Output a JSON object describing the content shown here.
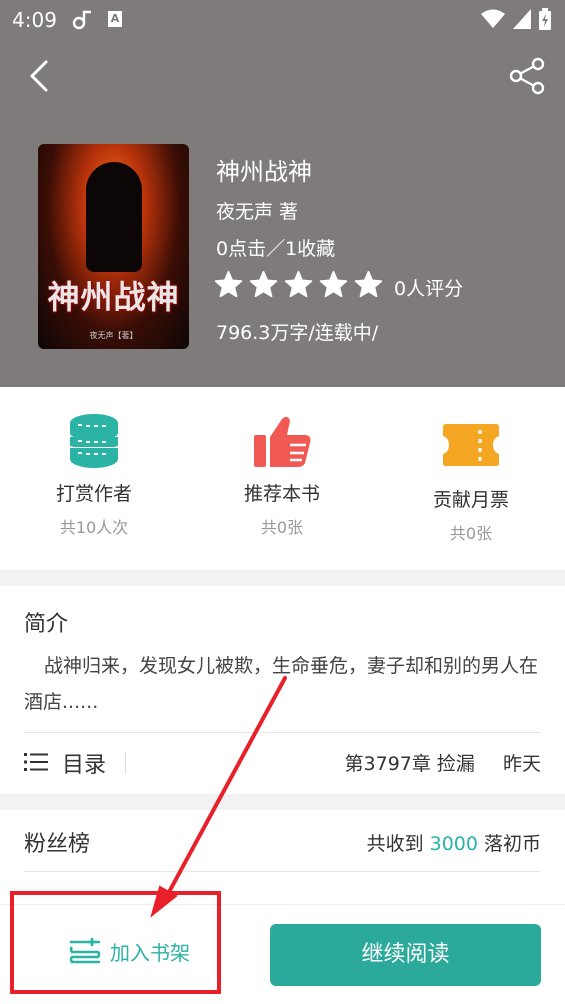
{
  "status_bar": {
    "time": "4:09",
    "icons": [
      "notification-icon",
      "a-badge-icon",
      "wifi-icon",
      "signal-icon",
      "battery-icon"
    ]
  },
  "header": {
    "back_icon": "back-arrow-icon",
    "share_icon": "share-icon",
    "background": "#7f7b7b"
  },
  "book": {
    "cover_title": "神州战神",
    "cover_author": "夜无声【著】",
    "title": "神州战神",
    "author": "夜无声  著",
    "stats": "0点击／1收藏",
    "rating_stars": 5,
    "rating_text": "0人评分",
    "meta": "796.3万字/连载中/"
  },
  "actions": [
    {
      "label": "打赏作者",
      "count": "共10人次",
      "icon": "coins-icon",
      "color": "#2bb3a5"
    },
    {
      "label": "推荐本书",
      "count": "共0张",
      "icon": "thumbs-up-icon",
      "color": "#f15a52"
    },
    {
      "label": "贡献月票",
      "count": "共0张",
      "icon": "ticket-icon",
      "color": "#f5a623"
    }
  ],
  "intro": {
    "title": "简介",
    "text": "战神归来，发现女儿被欺，生命垂危，妻子却和别的男人在酒店......",
    "toc_label": "目录",
    "latest_chapter": "第3797章 捡漏",
    "latest_time": "昨天"
  },
  "fans": {
    "title": "粉丝榜",
    "prefix": "共收到",
    "amount": "3000",
    "suffix": "落初币"
  },
  "bottom": {
    "add_shelf": "加入书架",
    "continue_read": "继续阅读"
  },
  "accent_color": "#2bb3a5",
  "annotation_color": "#e8202a"
}
